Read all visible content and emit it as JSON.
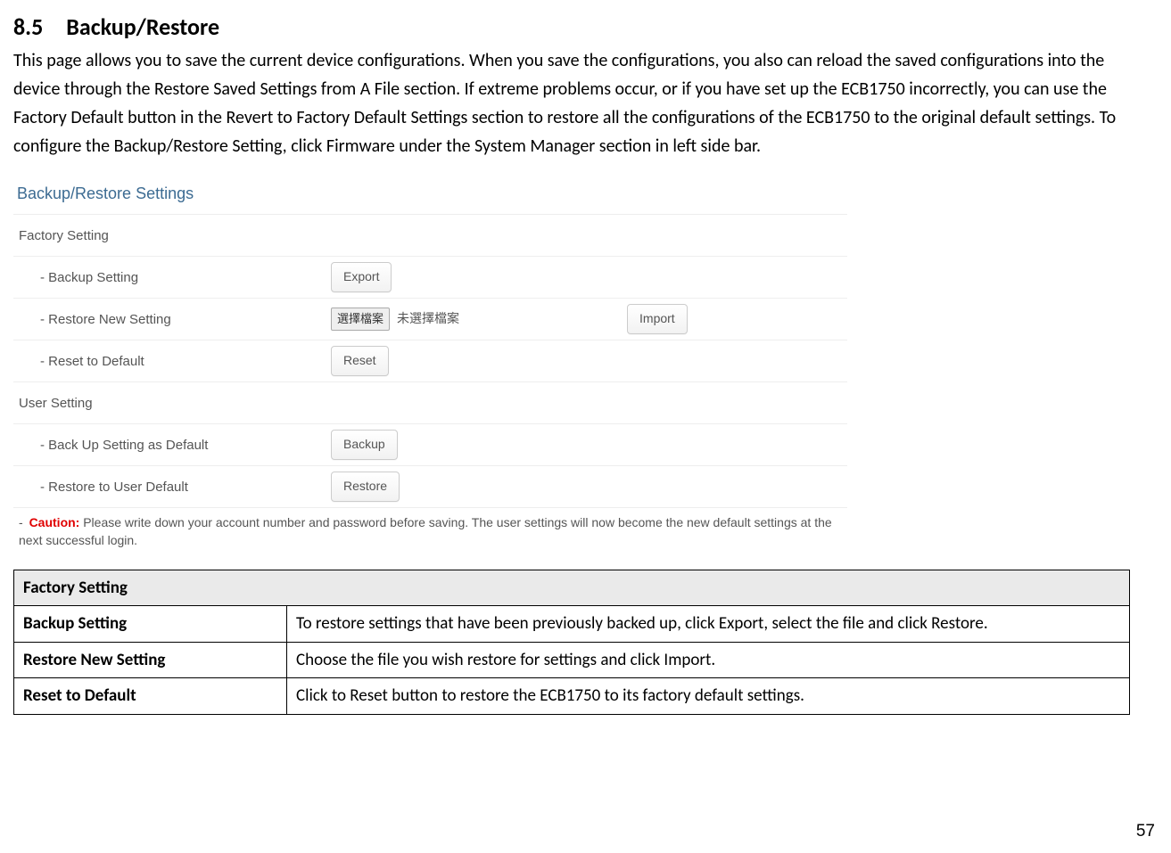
{
  "heading": "8.5 Backup/Restore",
  "body_text": "This page allows you to save the current device configurations. When you save the configurations, you also can reload the saved configurations into the device through the Restore Saved Settings from A File section. If extreme problems occur, or if you have set up the ECB1750 incorrectly, you can use the Factory Default button in the Revert to Factory Default Settings section to restore all the configurations of the ECB1750 to the original default settings. To configure the Backup/Restore Setting, click Firmware under the System Manager section in left side bar.",
  "panel": {
    "title": "Backup/Restore Settings",
    "factory_heading": "Factory Setting",
    "rows": {
      "backup": {
        "label": "-  Backup Setting",
        "btn": "Export"
      },
      "restore_new": {
        "label": "-  Restore New Setting",
        "choose": "選擇檔案",
        "status": "未選擇檔案",
        "btn": "Import"
      },
      "reset": {
        "label": "-  Reset to Default",
        "btn": "Reset"
      }
    },
    "user_heading": "User Setting",
    "user_rows": {
      "backup_default": {
        "label": "-  Back Up Setting as Default",
        "btn": "Backup"
      },
      "restore_user": {
        "label": "-  Restore to User Default",
        "btn": "Restore"
      }
    },
    "caution": {
      "dash": "-  ",
      "label": "Caution:",
      "text": " Please write down your account number and password before saving. The user settings will now become the new default settings at the next successful login."
    }
  },
  "table": {
    "section": "Factory Setting",
    "rows": [
      {
        "term": "Backup Setting",
        "desc": "To restore settings that have been previously backed up, click Export, select the file and click Restore."
      },
      {
        "term": "Restore New Setting",
        "desc": "Choose the file you wish restore for settings and click Import."
      },
      {
        "term": "Reset to Default",
        "desc": "Click to Reset button to restore the ECB1750 to its factory default settings."
      }
    ]
  },
  "page_number": "57"
}
